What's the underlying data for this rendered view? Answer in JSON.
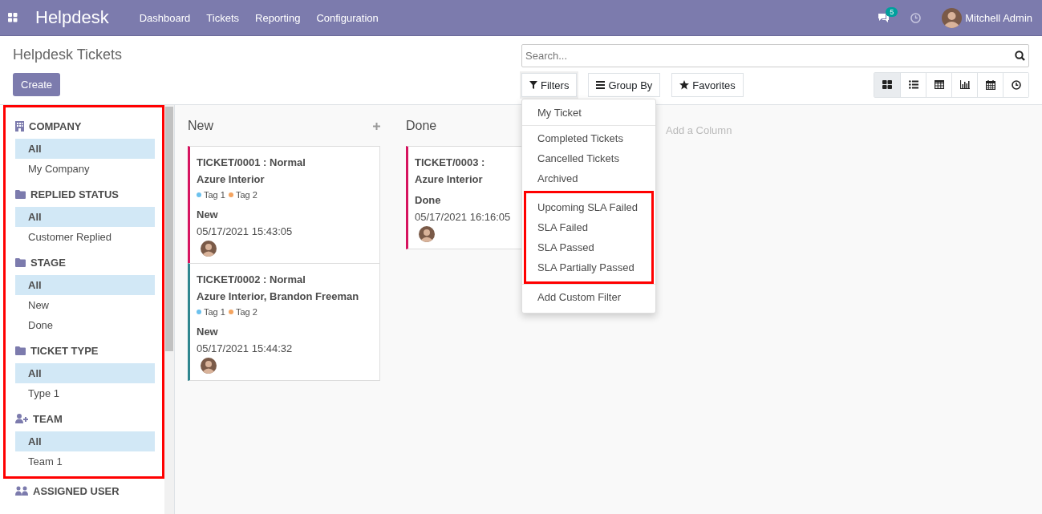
{
  "app": {
    "name": "Helpdesk",
    "menu": [
      "Dashboard",
      "Tickets",
      "Reporting",
      "Configuration"
    ],
    "messages_badge": "5",
    "user": "Mitchell Admin"
  },
  "page": {
    "title": "Helpdesk Tickets",
    "create_button": "Create"
  },
  "search": {
    "placeholder": "Search..."
  },
  "search_buttons": [
    {
      "kind": "filter",
      "label": "Filters",
      "expanded": true
    },
    {
      "kind": "group",
      "label": "Group By",
      "expanded": false
    },
    {
      "kind": "favorite",
      "label": "Favorites",
      "expanded": false
    }
  ],
  "views": [
    {
      "kind": "kanban",
      "selected": true
    },
    {
      "kind": "list",
      "selected": false
    },
    {
      "kind": "pivot",
      "selected": false
    },
    {
      "kind": "graph",
      "selected": false
    },
    {
      "kind": "calendar",
      "selected": false
    },
    {
      "kind": "activity",
      "selected": false
    }
  ],
  "filter_menu": {
    "groups": [
      {
        "highlighted": false,
        "items": [
          "My Ticket"
        ]
      },
      {
        "highlighted": false,
        "items": [
          "Completed Tickets",
          "Cancelled Tickets",
          "Archived"
        ]
      },
      {
        "highlighted": true,
        "items": [
          "Upcoming SLA Failed",
          "SLA Failed",
          "SLA Passed",
          "SLA Partially Passed"
        ]
      },
      {
        "highlighted": false,
        "items": [
          "Add Custom Filter"
        ]
      }
    ]
  },
  "sidebar": {
    "highlighted": true,
    "sections": [
      {
        "kind": "building",
        "title": "COMPANY",
        "items": [
          {
            "label": "All",
            "selected": true
          },
          {
            "label": "My Company",
            "selected": false
          }
        ]
      },
      {
        "kind": "folder",
        "title": "REPLIED STATUS",
        "items": [
          {
            "label": "All",
            "selected": true
          },
          {
            "label": "Customer Replied",
            "selected": false
          }
        ]
      },
      {
        "kind": "folder",
        "title": "STAGE",
        "items": [
          {
            "label": "All",
            "selected": true
          },
          {
            "label": "New",
            "selected": false
          },
          {
            "label": "Done",
            "selected": false
          }
        ]
      },
      {
        "kind": "folder",
        "title": "TICKET TYPE",
        "items": [
          {
            "label": "All",
            "selected": true
          },
          {
            "label": "Type 1",
            "selected": false
          }
        ]
      },
      {
        "kind": "user-plus",
        "title": "TEAM",
        "items": [
          {
            "label": "All",
            "selected": true
          },
          {
            "label": "Team 1",
            "selected": false
          }
        ]
      }
    ],
    "after_frame": [
      {
        "kind": "users",
        "title": "ASSIGNED USER"
      }
    ]
  },
  "kanban": {
    "columns": [
      {
        "title": "New",
        "cards": [
          {
            "title": "TICKET/0001 : Normal",
            "customer": "Azure Interior",
            "color": "#d6145f",
            "tags": [
              {
                "label": "Tag 1",
                "color": "#6cc1ed"
              },
              {
                "label": "Tag 2",
                "color": "#f4a460"
              }
            ],
            "stage": "New",
            "date": "05/17/2021 15:43:05"
          },
          {
            "title": "TICKET/0002 : Normal",
            "customer": "Azure Interior, Brandon Freeman",
            "color": "#30868f",
            "tags": [
              {
                "label": "Tag 1",
                "color": "#6cc1ed"
              },
              {
                "label": "Tag 2",
                "color": "#f4a460"
              }
            ],
            "stage": "New",
            "date": "05/17/2021 15:44:32"
          }
        ]
      },
      {
        "title": "Done",
        "cards": [
          {
            "title": "TICKET/0003 :",
            "customer": "Azure Interior",
            "color": "#d6145f",
            "stage": "Done",
            "date": "05/17/2021 16:16:05"
          }
        ]
      }
    ],
    "add_column": "Add a Column"
  }
}
